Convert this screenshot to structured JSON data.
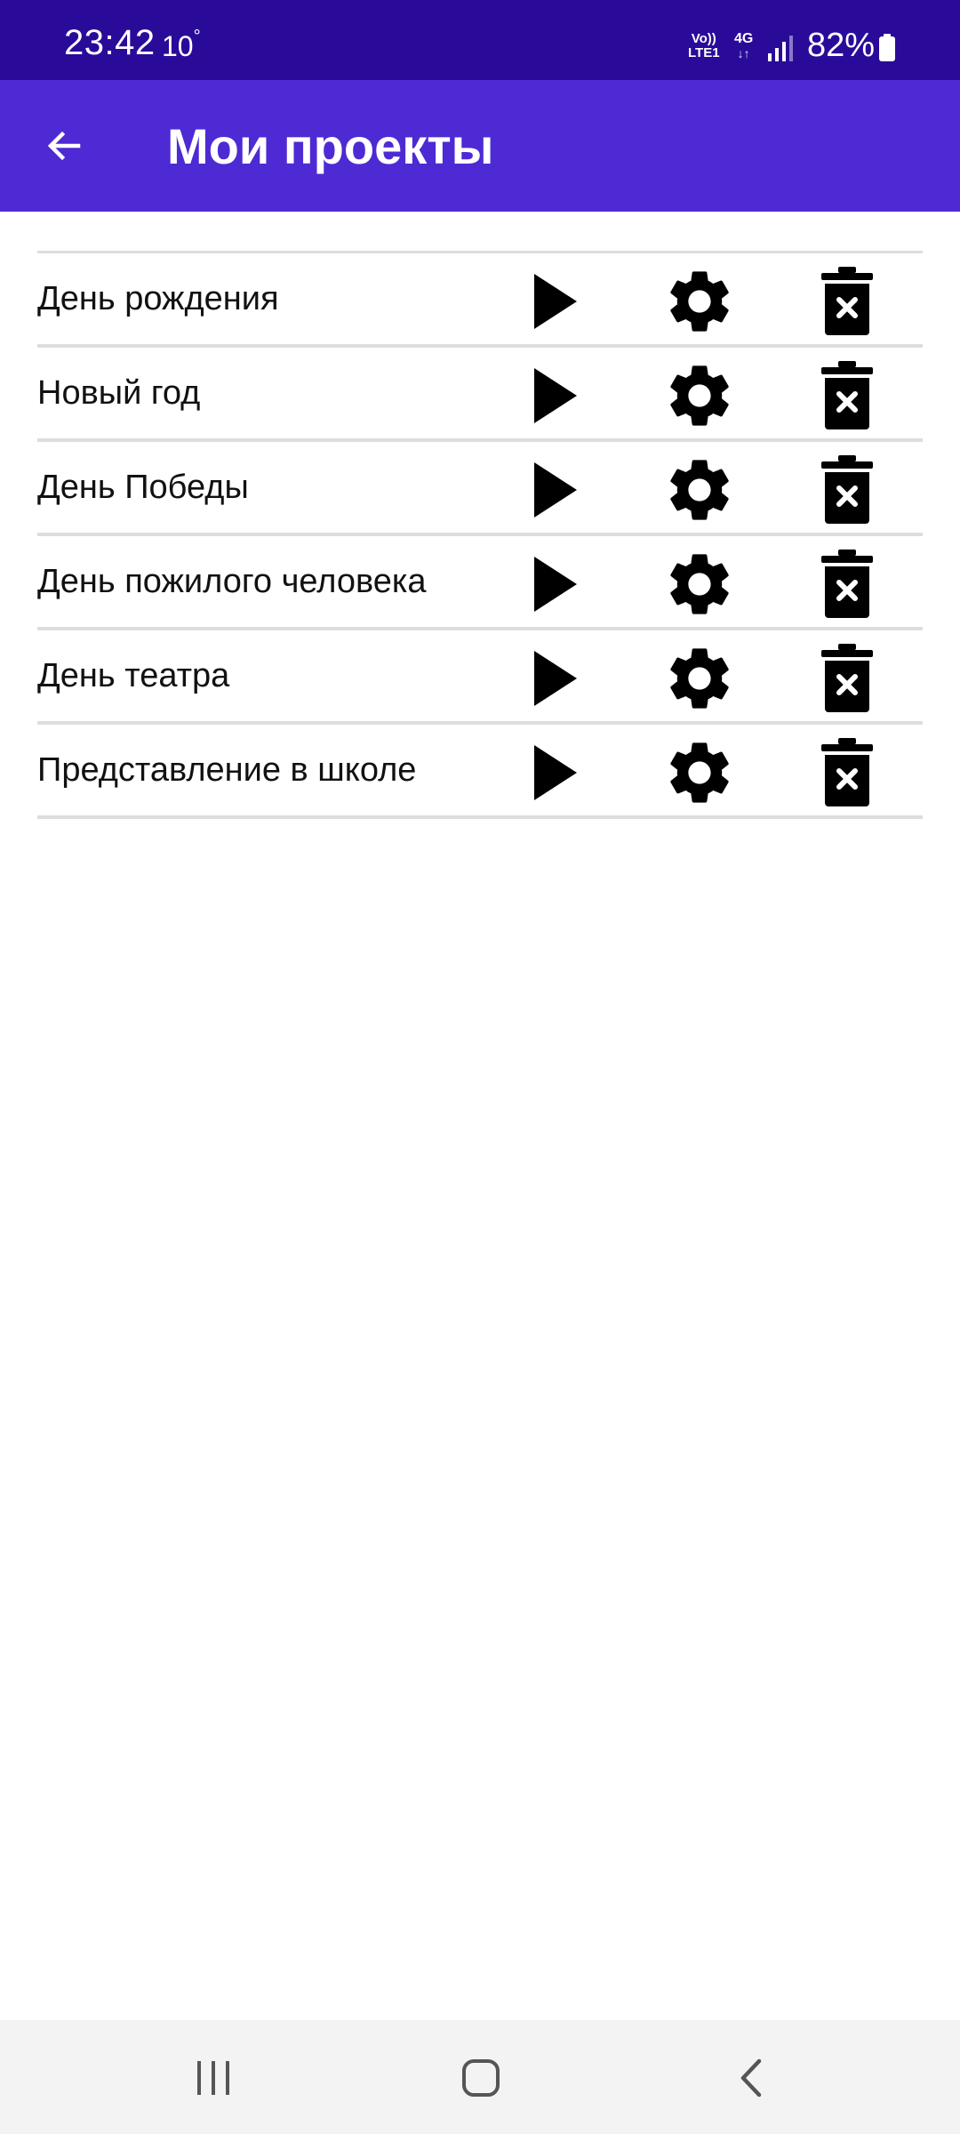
{
  "status_bar": {
    "time": "23:42",
    "temperature": "10",
    "degree_symbol": "°",
    "volte_top": "Vo))",
    "volte_bottom": "LTE1",
    "network": "4G",
    "network_arrows": "↓↑",
    "battery": "82%"
  },
  "app_bar": {
    "title": "Мои проекты",
    "back_icon": "arrow-left-icon",
    "background_color": "#4e2ad4"
  },
  "status_bar_color": "#2a0b99",
  "projects": [
    {
      "name": "День рождения"
    },
    {
      "name": "Новый год"
    },
    {
      "name": "День Победы"
    },
    {
      "name": "День пожилого человека"
    },
    {
      "name": "День театра"
    },
    {
      "name": "Представление в школе"
    }
  ],
  "row_icons": [
    "play-icon",
    "gear-icon",
    "trash-delete-icon"
  ],
  "nav_bar": {
    "buttons": [
      "recents-icon",
      "home-icon",
      "back-icon"
    ]
  }
}
